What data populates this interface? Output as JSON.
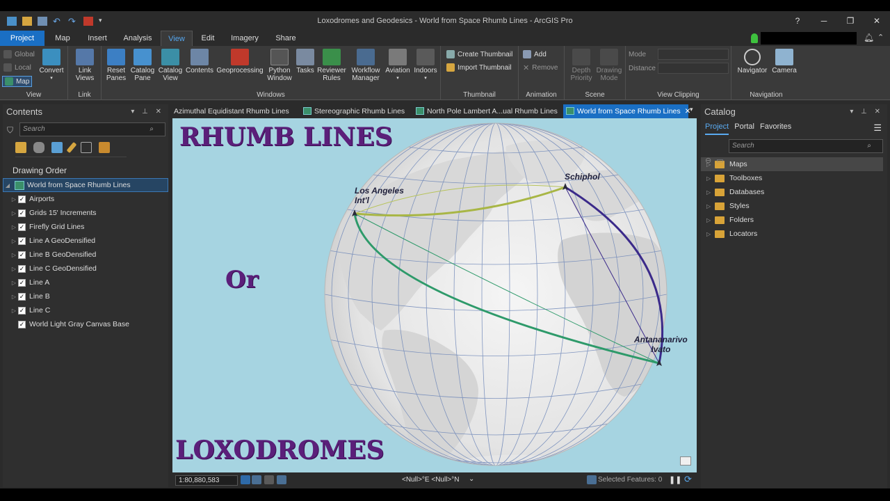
{
  "window": {
    "title": "Loxodromes and Geodesics - World from Space Rhumb Lines - ArcGIS Pro",
    "help": "?",
    "minimize": "─",
    "restore": "❐",
    "close": "✕"
  },
  "ribbon_tabs": [
    "Project",
    "Map",
    "Insert",
    "Analysis",
    "View",
    "Edit",
    "Imagery",
    "Share"
  ],
  "active_tab": "View",
  "ribbon": {
    "view_group": {
      "label": "View",
      "global": "Global",
      "local": "Local",
      "map": "Map",
      "convert": "Convert"
    },
    "link_group": {
      "label": "Link",
      "link_views": "Link Views"
    },
    "windows_group": {
      "label": "Windows",
      "buttons": [
        "Reset Panes",
        "Catalog Pane",
        "Catalog View",
        "Contents",
        "Geoprocessing",
        "Python Window",
        "Tasks",
        "Reviewer Rules",
        "Workflow Manager",
        "Aviation",
        "Indoors"
      ]
    },
    "thumbnail_group": {
      "label": "Thumbnail",
      "create": "Create Thumbnail",
      "import": "Import Thumbnail"
    },
    "animation_group": {
      "label": "Animation",
      "add": "Add",
      "remove": "Remove"
    },
    "scene_group": {
      "label": "Scene",
      "depth_priority": "Depth Priority",
      "drawing_mode": "Drawing Mode"
    },
    "clipping_group": {
      "label": "View Clipping",
      "mode": "Mode",
      "distance": "Distance"
    },
    "navigation_group": {
      "label": "Navigation",
      "navigator": "Navigator",
      "camera": "Camera"
    }
  },
  "contents": {
    "title": "Contents",
    "search_placeholder": "Search",
    "drawing_order": "Drawing Order",
    "map_name": "World from Space Rhumb Lines",
    "layers": [
      {
        "name": "Airports",
        "checked": true,
        "expandable": true
      },
      {
        "name": "Grids 15' Increments",
        "checked": true,
        "expandable": true
      },
      {
        "name": "Firefly Grid Lines",
        "checked": true,
        "expandable": true
      },
      {
        "name": "Line A GeoDensified",
        "checked": true,
        "expandable": true
      },
      {
        "name": "Line B GeoDensified",
        "checked": true,
        "expandable": true
      },
      {
        "name": "Line C GeoDensified",
        "checked": true,
        "expandable": true
      },
      {
        "name": "Line A",
        "checked": true,
        "expandable": true
      },
      {
        "name": "Line B",
        "checked": true,
        "expandable": true
      },
      {
        "name": "Line C",
        "checked": true,
        "expandable": true
      },
      {
        "name": "World Light Gray Canvas Base",
        "checked": true,
        "expandable": false
      }
    ]
  },
  "map_tabs": [
    {
      "label": "Azimuthal Equidistant Rhumb Lines",
      "active": false
    },
    {
      "label": "Stereographic Rhumb Lines",
      "active": false
    },
    {
      "label": "North Pole Lambert A...ual Rhumb Lines",
      "active": false
    },
    {
      "label": "World from Space Rhumb Lines",
      "active": true
    }
  ],
  "map": {
    "headline_top": "RHUMB LINES",
    "headline_mid": "Or",
    "headline_bottom": "LOXODROMES",
    "cities": {
      "la": "Los Angeles\nInt'l",
      "schiphol": "Schiphol",
      "antananarivo": "Antananarivo\nIvato"
    },
    "colors": {
      "ocean": "#a6d4e1",
      "line_a": "#a8b645",
      "line_b": "#3b2a8a",
      "line_c": "#2e9a6a",
      "title": "#5b1f7a"
    }
  },
  "status": {
    "scale": "1:80,880,583",
    "coords": "<Null>°E <Null>°N",
    "selected": "Selected Features: 0"
  },
  "catalog": {
    "title": "Catalog",
    "tabs": [
      "Project",
      "Portal",
      "Favorites"
    ],
    "active_tab": "Project",
    "search_placeholder": "Search",
    "items": [
      "Maps",
      "Toolboxes",
      "Databases",
      "Styles",
      "Folders",
      "Locators"
    ]
  }
}
